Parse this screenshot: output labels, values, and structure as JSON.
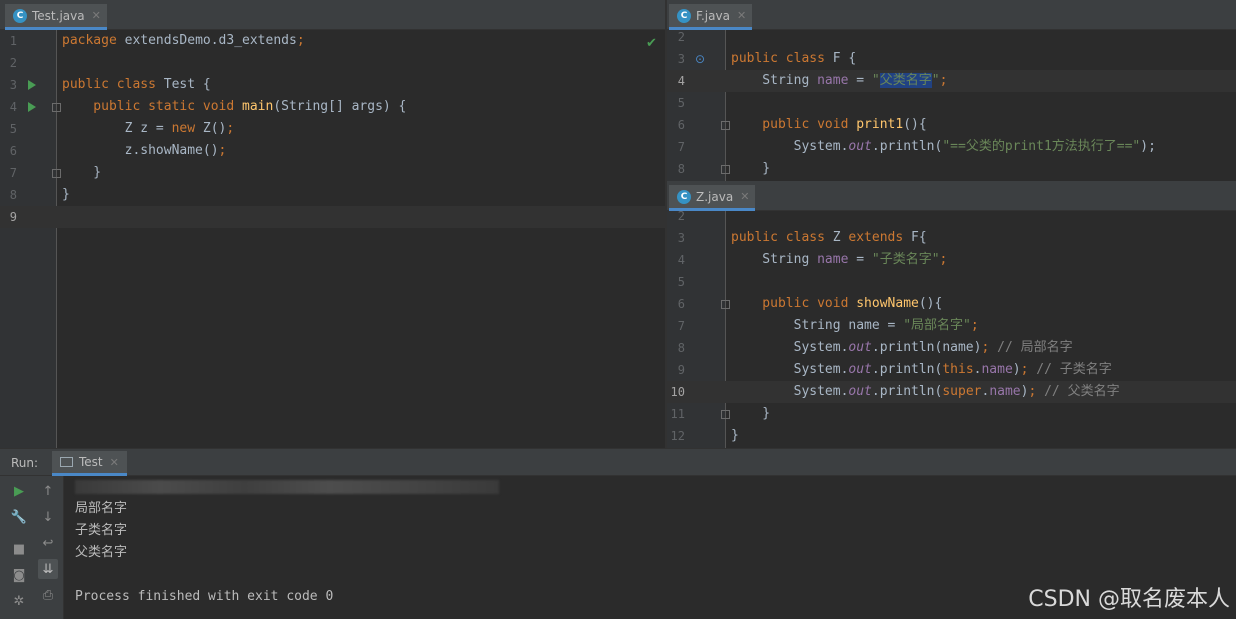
{
  "left_editor": {
    "tab": {
      "icon": "C",
      "label": "Test.java",
      "close": "✕"
    },
    "lines": [
      {
        "n": "1",
        "tokens": [
          {
            "t": "package ",
            "c": "kw"
          },
          {
            "t": "extendsDemo.d3_extends",
            "c": ""
          },
          {
            "t": ";",
            "c": "kw"
          }
        ]
      },
      {
        "n": "2",
        "tokens": []
      },
      {
        "n": "3",
        "tokens": [
          {
            "t": "public class ",
            "c": "kw"
          },
          {
            "t": "Test {",
            "c": ""
          }
        ]
      },
      {
        "n": "4",
        "tokens": [
          {
            "t": "    public static void ",
            "c": "kw"
          },
          {
            "t": "main",
            "c": "fn"
          },
          {
            "t": "(String[] args) {",
            "c": ""
          }
        ]
      },
      {
        "n": "5",
        "tokens": [
          {
            "t": "        Z z = ",
            "c": ""
          },
          {
            "t": "new ",
            "c": "kw"
          },
          {
            "t": "Z()",
            "c": ""
          },
          {
            "t": ";",
            "c": "kw"
          }
        ]
      },
      {
        "n": "6",
        "tokens": [
          {
            "t": "        z.showName()",
            "c": ""
          },
          {
            "t": ";",
            "c": "kw"
          }
        ]
      },
      {
        "n": "7",
        "tokens": [
          {
            "t": "    }",
            "c": ""
          }
        ]
      },
      {
        "n": "8",
        "tokens": [
          {
            "t": "}",
            "c": ""
          }
        ]
      },
      {
        "n": "9",
        "tokens": []
      }
    ]
  },
  "f_editor": {
    "tab": {
      "icon": "C",
      "label": "F.java",
      "close": "✕"
    },
    "lines": [
      {
        "n": "2",
        "tokens": []
      },
      {
        "n": "3",
        "tokens": [
          {
            "t": "public class ",
            "c": "kw"
          },
          {
            "t": "F {",
            "c": ""
          }
        ]
      },
      {
        "n": "4",
        "tokens": [
          {
            "t": "    String ",
            "c": ""
          },
          {
            "t": "name",
            "c": "fld"
          },
          {
            "t": " = ",
            "c": ""
          },
          {
            "t": "\"",
            "c": "str"
          },
          {
            "t": "父类名字",
            "c": "str sel"
          },
          {
            "t": "\"",
            "c": "str"
          },
          {
            "t": ";",
            "c": "kw"
          }
        ]
      },
      {
        "n": "5",
        "tokens": []
      },
      {
        "n": "6",
        "tokens": [
          {
            "t": "    public void ",
            "c": "kw"
          },
          {
            "t": "print1",
            "c": "fn"
          },
          {
            "t": "(){",
            "c": ""
          }
        ]
      },
      {
        "n": "7",
        "tokens": [
          {
            "t": "        System.",
            "c": ""
          },
          {
            "t": "out",
            "c": "sfld"
          },
          {
            "t": ".println(",
            "c": ""
          },
          {
            "t": "\"==父类的print1方法执行了==\"",
            "c": "str"
          },
          {
            "t": ");",
            "c": ""
          }
        ]
      },
      {
        "n": "8",
        "tokens": [
          {
            "t": "    }",
            "c": ""
          }
        ]
      }
    ]
  },
  "z_editor": {
    "tab": {
      "icon": "C",
      "label": "Z.java",
      "close": "✕"
    },
    "lines": [
      {
        "n": "2",
        "tokens": []
      },
      {
        "n": "3",
        "tokens": [
          {
            "t": "public class ",
            "c": "kw"
          },
          {
            "t": "Z ",
            "c": ""
          },
          {
            "t": "extends ",
            "c": "kw"
          },
          {
            "t": "F{",
            "c": ""
          }
        ]
      },
      {
        "n": "4",
        "tokens": [
          {
            "t": "    String ",
            "c": ""
          },
          {
            "t": "name",
            "c": "fld"
          },
          {
            "t": " = ",
            "c": ""
          },
          {
            "t": "\"子类名字\"",
            "c": "str"
          },
          {
            "t": ";",
            "c": "kw"
          }
        ]
      },
      {
        "n": "5",
        "tokens": []
      },
      {
        "n": "6",
        "tokens": [
          {
            "t": "    public void ",
            "c": "kw"
          },
          {
            "t": "showName",
            "c": "fn"
          },
          {
            "t": "(){",
            "c": ""
          }
        ]
      },
      {
        "n": "7",
        "tokens": [
          {
            "t": "        String name = ",
            "c": ""
          },
          {
            "t": "\"局部名字\"",
            "c": "str"
          },
          {
            "t": ";",
            "c": "kw"
          }
        ]
      },
      {
        "n": "8",
        "tokens": [
          {
            "t": "        System.",
            "c": ""
          },
          {
            "t": "out",
            "c": "sfld"
          },
          {
            "t": ".println(name)",
            "c": ""
          },
          {
            "t": "; ",
            "c": "kw"
          },
          {
            "t": "// 局部名字",
            "c": "cmt"
          }
        ]
      },
      {
        "n": "9",
        "tokens": [
          {
            "t": "        System.",
            "c": ""
          },
          {
            "t": "out",
            "c": "sfld"
          },
          {
            "t": ".println(",
            "c": ""
          },
          {
            "t": "this",
            "c": "kw"
          },
          {
            "t": ".",
            "c": ""
          },
          {
            "t": "name",
            "c": "fld"
          },
          {
            "t": ")",
            "c": ""
          },
          {
            "t": "; ",
            "c": "kw"
          },
          {
            "t": "// 子类名字",
            "c": "cmt"
          }
        ]
      },
      {
        "n": "10",
        "tokens": [
          {
            "t": "        System.",
            "c": ""
          },
          {
            "t": "out",
            "c": "sfld"
          },
          {
            "t": ".println(",
            "c": ""
          },
          {
            "t": "super",
            "c": "kw"
          },
          {
            "t": ".",
            "c": ""
          },
          {
            "t": "name",
            "c": "fld"
          },
          {
            "t": ")",
            "c": ""
          },
          {
            "t": "; ",
            "c": "kw"
          },
          {
            "t": "// 父类名字",
            "c": "cmt"
          }
        ]
      },
      {
        "n": "11",
        "tokens": [
          {
            "t": "    }",
            "c": ""
          }
        ]
      },
      {
        "n": "12",
        "tokens": [
          {
            "t": "}",
            "c": ""
          }
        ]
      }
    ]
  },
  "run_panel": {
    "label": "Run:",
    "tab_label": "Test",
    "tab_close": "✕",
    "output": [
      "局部名字",
      "子类名字",
      "父类名字",
      "",
      "Process finished with exit code 0"
    ]
  },
  "watermark": "CSDN @取名废本人",
  "colors": {
    "keyword": "#cc7832",
    "string": "#6a8759",
    "field": "#9876aa",
    "method": "#ffc66d",
    "comment": "#808080",
    "accent": "#4a88c7",
    "run_green": "#499c54"
  }
}
